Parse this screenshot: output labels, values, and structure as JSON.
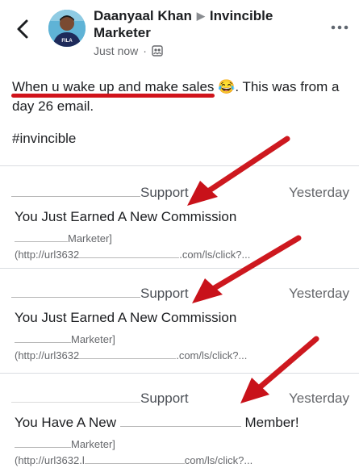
{
  "header": {
    "author": "Daanyaal Khan",
    "group": "Invincible",
    "group_line2": "Marketer",
    "time": "Just now",
    "separator": "·",
    "avatar_text": "FILA"
  },
  "post": {
    "highlight": "When u wake up and make sales",
    "emoji": "😂",
    "rest": ". This was from a day 26 email.",
    "hashtag": "#invincible"
  },
  "emails": [
    {
      "from": "Support",
      "date": "Yesterday",
      "subject": "You Just Earned A New Commission",
      "snippet1": "Marketer]",
      "snippet2_a": "(http://url3632",
      "snippet2_b": ".com/ls/click?..."
    },
    {
      "from": "Support",
      "date": "Yesterday",
      "subject": "You Just Earned A New Commission",
      "snippet1": "Marketer]",
      "snippet2_a": "(http://url3632",
      "snippet2_b": "(http://url3632",
      "snippet2_c": ".com/ls/click?..."
    },
    {
      "from": "Support",
      "date": "Yesterday",
      "subject_a": "You Have A New",
      "subject_b": "Member!",
      "snippet1": "Marketer]",
      "snippet2_a": "(http://url3632.l",
      "snippet2_b": "com/ls/click?..."
    }
  ],
  "colors": {
    "annotation": "#d0131b",
    "text": "#1c1e21",
    "muted": "#65676b"
  },
  "icons": [
    "back-chevron-icon",
    "more-options-icon",
    "audience-icon",
    "annotation-arrow-icon"
  ]
}
